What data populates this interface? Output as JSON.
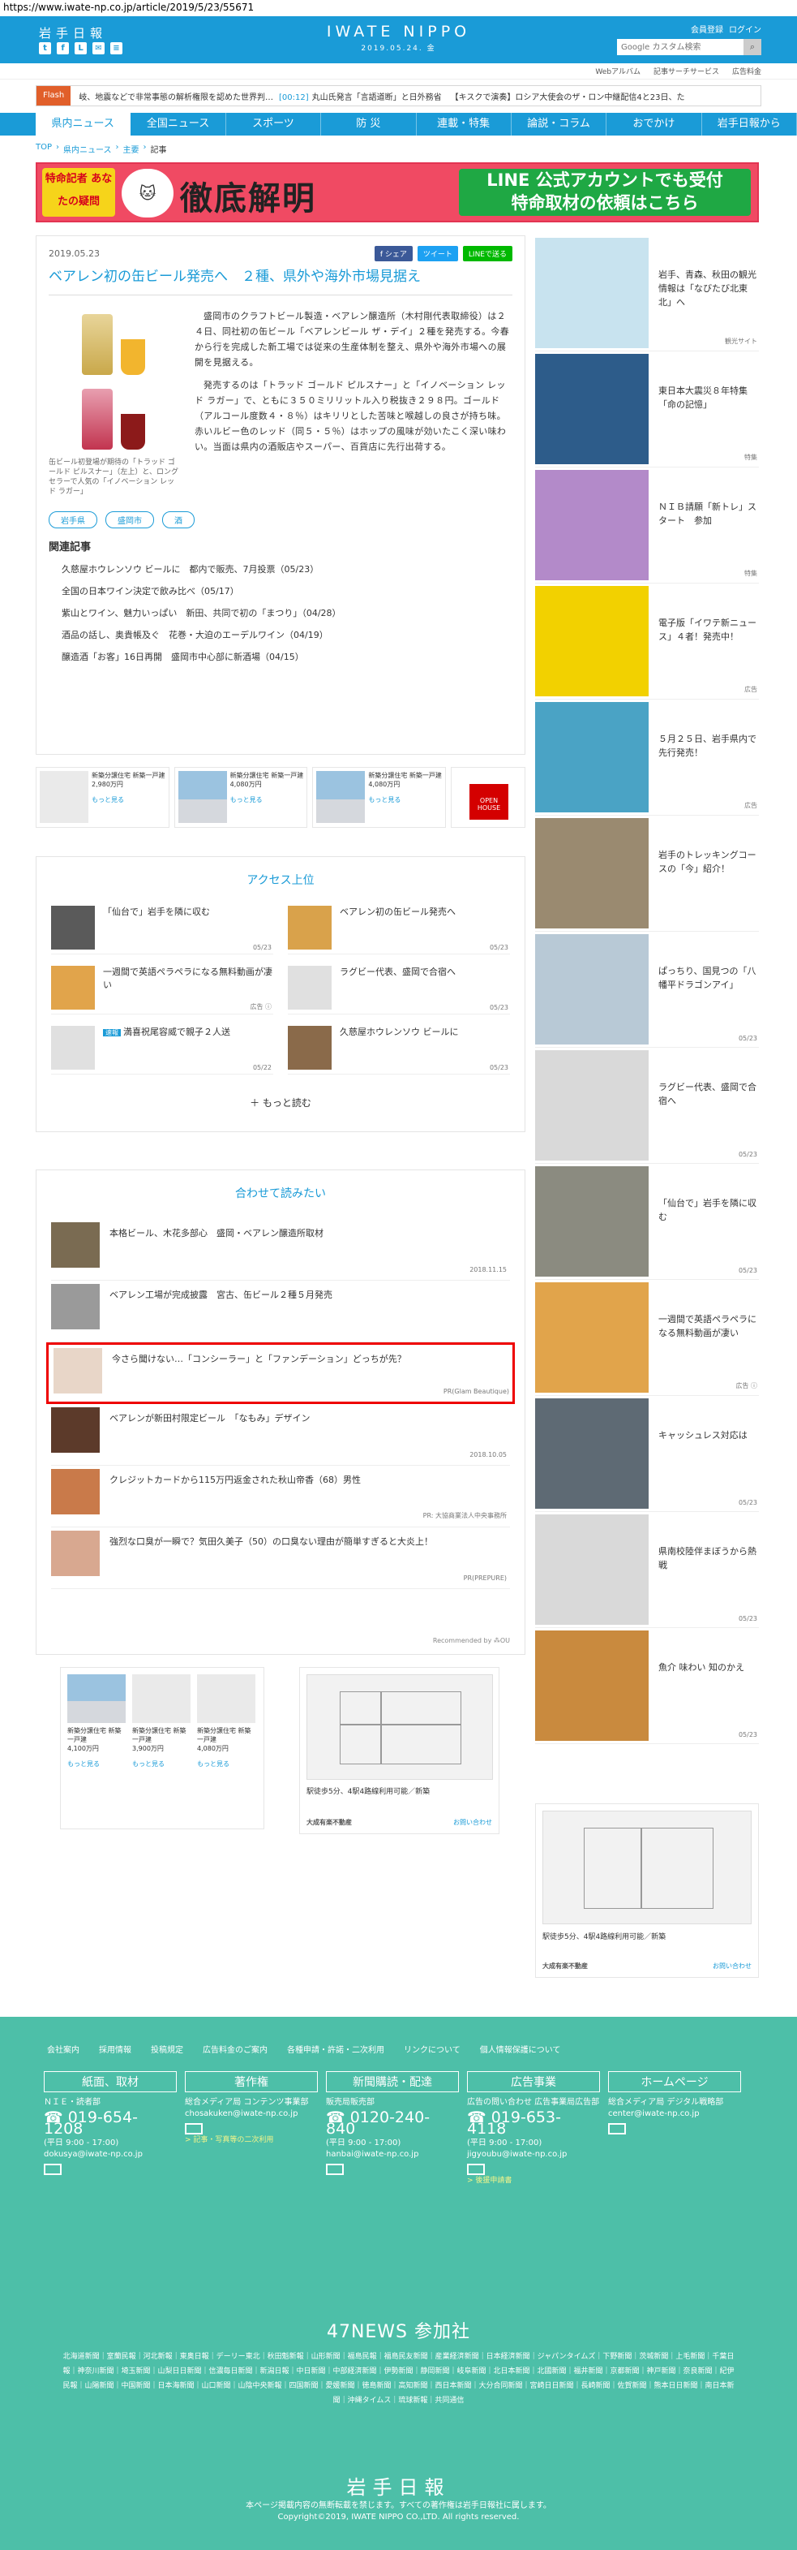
{
  "url": "https://www.iwate-np.co.jp/article/2019/5/23/55671",
  "header": {
    "logo_jp": "岩手日報",
    "brand": "IWATE NIPPO",
    "date": "2019.05.24. 金",
    "login_links": [
      "会員登録",
      "ログイン"
    ],
    "search_placeholder": "Google カスタム検索",
    "social": [
      "t",
      "f",
      "L",
      "✉",
      "≡"
    ]
  },
  "subnav": [
    "Webアルバム",
    "記事サーチサービス",
    "広告料金"
  ],
  "flash": {
    "tag": "Flash",
    "items": [
      {
        "time": "",
        "text": "岐、地震などで非常事態の解析権限を認めた世界判…"
      },
      {
        "time": "[00:12]",
        "text": "丸山氏発言「言語道断」と日外務省"
      },
      {
        "time": "",
        "text": "【キスクで演奏】ロシア大使会のザ・ロン中継配信4と23日、た"
      }
    ]
  },
  "mainnav": [
    "県内ニュース",
    "全国ニュース",
    "スポーツ",
    "防 災",
    "連載・特集",
    "論説・コラム",
    "おでかけ",
    "岩手日報から"
  ],
  "breadcrumb": [
    "TOP",
    "県内ニュース",
    "主要",
    "記事"
  ],
  "banner": {
    "left_text": "特命記者 あなたの疑問",
    "title": "徹底解明",
    "right_line1": "LINE 公式アカウントでも受付",
    "right_line2": "特命取材の依頼はこちら"
  },
  "article": {
    "date": "2019.05.23",
    "share": [
      "f シェア",
      "ツイート",
      "LINEで送る"
    ],
    "title": "ベアレン初の缶ビール発売へ　２種、県外や海外市場見据え",
    "caption": "缶ビール初登場が期待の「トラッド ゴールド ピルスナー」（左上）と、ロングセラーで人気の「イノベーション レッド ラガー」",
    "paragraphs": [
      "盛岡市のクラフトビール製造・ベアレン醸造所（木村剛代表取締役）は２４日、同社初の缶ビール「ベアレンビール ザ・デイ」２種を発売する。今春から行を完成した新工場では従来の生産体制を整え、県外や海外市場への展開を見据える。",
      "発売するのは「トラッド ゴールド ピルスナー」と「イノベーション レッド ラガー」で、ともに３５０ミリリットル入り税抜き２９８円。ゴールド（アルコール度数４・８％）はキリリとした苦味と喉越しの良さが持ち味。赤いルビー色のレッド（同５・５％）はホップの風味が効いたこく深い味わい。当面は県内の酒販店やスーパー、百貨店に先行出荷する。"
    ],
    "tags": [
      "岩手県",
      "盛岡市",
      "酒"
    ],
    "related_heading": "関連記事",
    "related": [
      "久慈屋ホウレンソウ ビールに　都内で販売、7月投票（05/23）",
      "全国の日本ワイン決定で飲み比べ（05/17）",
      "紫山とワイン、魅力いっぱい　新田、共同で初の「まつり」（04/28）",
      "酒品の話し、奥貴帳及ぐ　花巻・大迫のエーデルワイン（04/19）",
      "醸造酒「お客」16日再開　盛岡市中心部に新酒場（04/15）"
    ]
  },
  "ad_strip": [
    {
      "title": "新築分譲住宅 新築一戸建",
      "price": "2,980万円",
      "more": "もっと見る"
    },
    {
      "title": "新築分譲住宅 新築一戸建",
      "price": "4,080万円",
      "more": "もっと見る"
    },
    {
      "title": "新築分譲住宅 新築一戸建",
      "price": "4,080万円",
      "more": "もっと見る"
    },
    {
      "title": "OPEN HOUSE"
    }
  ],
  "access": {
    "title": "アクセス上位",
    "items": [
      {
        "text": "「仙台で」岩手を隣に収む",
        "date": "05/23",
        "badge": ""
      },
      {
        "text": "ベアレン初の缶ビール発売へ",
        "date": "05/23",
        "badge": ""
      },
      {
        "text": "一週間で英語ペラペラになる無料動画が凄い",
        "date": "広告 ⓘ",
        "badge": ""
      },
      {
        "text": "ラグビー代表、盛岡で合宿へ",
        "date": "05/23",
        "badge": ""
      },
      {
        "text": "満喜祝尾容威で親子２人送",
        "date": "05/22",
        "badge": "速報"
      },
      {
        "text": "久慈屋ホウレンソウ ビールに",
        "date": "05/23",
        "badge": ""
      }
    ],
    "more": "＋ もっと読む"
  },
  "reco": {
    "title": "合わせて読みたい",
    "items": [
      {
        "text": "本格ビール、木花多部心　盛岡・ベアレン醸造所取材",
        "meta": "2018.11.15"
      },
      {
        "text": "ベアレン工場が完成披露　宮古、缶ビール２種５月発売",
        "meta": ""
      },
      {
        "text": "今さら聞けない…「コンシーラー」と「ファンデーション」どっちが先？",
        "meta": "PR(Glam Beautique)"
      },
      {
        "text": "ベアレンが新田村限定ビール　「なもみ」デザイン",
        "meta": "2018.10.05"
      },
      {
        "text": "クレジットカードから115万円返金された秋山帝香（68）男性",
        "meta": "PR: 大協商業法人中央事務所"
      },
      {
        "text": "強烈な口臭が一瞬で？気田久美子（50）の口臭ない理由が簡単すぎると大炎上！",
        "meta": "PR(PREPURE)"
      }
    ],
    "recommended": "Recommended by  ⁂OU"
  },
  "bottom_ads": {
    "left": [
      {
        "title": "新築分譲住宅 新築一戸建",
        "price": "4,100万円",
        "more": "もっと見る"
      },
      {
        "title": "新築分譲住宅 新築一戸建",
        "price": "3,900万円",
        "more": "もっと見る"
      },
      {
        "title": "新築分譲住宅 新築一戸建",
        "price": "4,080万円",
        "more": "もっと見る"
      }
    ],
    "right_caption": "駅徒歩5分、4駅4路線利用可能／新築",
    "right_company": "大成有楽不動産",
    "right_link": "お問い合わせ"
  },
  "sidebar": [
    {
      "text": "岩手、青森、秋田の観光情報は「なびたび北東北」へ",
      "meta": "観光サイト",
      "color": "#c8e3ef"
    },
    {
      "text": "東日本大震災８年特集「命の記憶」",
      "meta": "特集",
      "color": "#2d5c8a"
    },
    {
      "text": "ＮＩＢ請願「新トレ」スタート　参加",
      "meta": "特集",
      "color": "#b38ac9"
    },
    {
      "text": "電子版「イワテ新ニュース」４者！発売中！",
      "meta": "広告",
      "color": "#f2d100"
    },
    {
      "text": "５月２５日、岩手県内で先行発売！",
      "meta": "広告",
      "color": "#4aa3c5"
    },
    {
      "text": "岩手のトレッキングコースの「今」紹介！",
      "meta": "",
      "color": "#9a8a70"
    },
    {
      "text": "ぱっちり、国見つの「八幡平ドラゴンアイ」",
      "meta": "05/23",
      "color": "#b8c9d6"
    },
    {
      "text": "ラグビー代表、盛岡で合宿へ",
      "meta": "05/23",
      "color": "#d9d9d9"
    },
    {
      "text": "「仙台で」岩手を隣に収む",
      "meta": "05/23",
      "color": "#8b8b80"
    },
    {
      "text": "一週間で英語ペラペラになる無料動画が凄い",
      "meta": "広告 ⓘ",
      "color": "#e1a44b"
    },
    {
      "text": "キャッシュレス対応は",
      "meta": "05/23",
      "color": "#5e6a74"
    },
    {
      "text": "県南校陸伴まぼうから熱戦",
      "meta": "05/23",
      "color": "#d9d9d9"
    },
    {
      "text": "魚介 味わい 知のかえ",
      "meta": "05/23",
      "color": "#c98a3e"
    }
  ],
  "side_ad": {
    "caption": "駅徒歩5分、4駅4路線利用可能／新築",
    "company": "大成有楽不動産",
    "link": "お問い合わせ"
  },
  "footer": {
    "links": [
      "会社案内",
      "採用情報",
      "投稿規定",
      "広告料金のご案内",
      "各種申請・許諾・二次利用",
      "リンクについて",
      "個人情報保護について"
    ],
    "cols": [
      {
        "head": "紙面、取材",
        "org": "ＮＩＥ・読者部",
        "tel": "019-654-1208",
        "hours": "(平日 9:00 - 17:00)",
        "mail": "dokusya@iwate-np.co.jp",
        "link": ""
      },
      {
        "head": "著作権",
        "org": "総合メディア局 コンテンツ事業部",
        "tel": "",
        "hours": "",
        "mail": "chosakuken@iwate-np.co.jp",
        "link": "> 記事・写真等の二次利用"
      },
      {
        "head": "新聞購読・配達",
        "org": "販売局販売部",
        "tel": "0120-240-840",
        "hours": "(平日 9:00 - 17:00)",
        "mail": "hanbai@iwate-np.co.jp",
        "link": ""
      },
      {
        "head": "広告事業",
        "org": "広告の問い合わせ 広告事業局広告部",
        "tel": "019-653-4118",
        "hours": "(平日 9:00 - 17:00)",
        "mail": "jigyoubu@iwate-np.co.jp",
        "link": "> 後援申請書"
      },
      {
        "head": "ホームページ",
        "org": "総合メディア局 デジタル戦略部",
        "tel": "",
        "hours": "",
        "mail": "center@iwate-np.co.jp",
        "link": ""
      }
    ],
    "news47": "47NEWS 参加社",
    "papers": "北海道新聞｜室蘭民報｜河北新報｜東奥日報｜デーリー東北｜秋田魁新報｜山形新聞｜福島民報｜福島民友新聞｜産業経済新聞｜日本経済新聞｜ジャパンタイムズ｜下野新聞｜茨城新聞｜上毛新聞｜千葉日報｜神奈川新聞｜埼玉新聞｜山梨日日新聞｜信濃毎日新聞｜新潟日報｜中日新聞｜中部経済新聞｜伊勢新聞｜静岡新聞｜岐阜新聞｜北日本新聞｜北國新聞｜福井新聞｜京都新聞｜神戸新聞｜奈良新聞｜紀伊民報｜山陽新聞｜中国新聞｜日本海新聞｜山口新聞｜山陰中央新報｜四国新聞｜愛媛新聞｜徳島新聞｜高知新聞｜西日本新聞｜大分合同新聞｜宮崎日日新聞｜長崎新聞｜佐賀新聞｜熊本日日新聞｜南日本新聞｜沖縄タイムス｜琉球新報｜共同通信",
    "logo": "岩手日報",
    "notice": "本ページ掲載内容の無断転載を禁じます。すべての著作権は岩手日報社に属します。",
    "copyright": "Copyright©2019, IWATE NIPPO CO.,LTD. All rights reserved."
  }
}
